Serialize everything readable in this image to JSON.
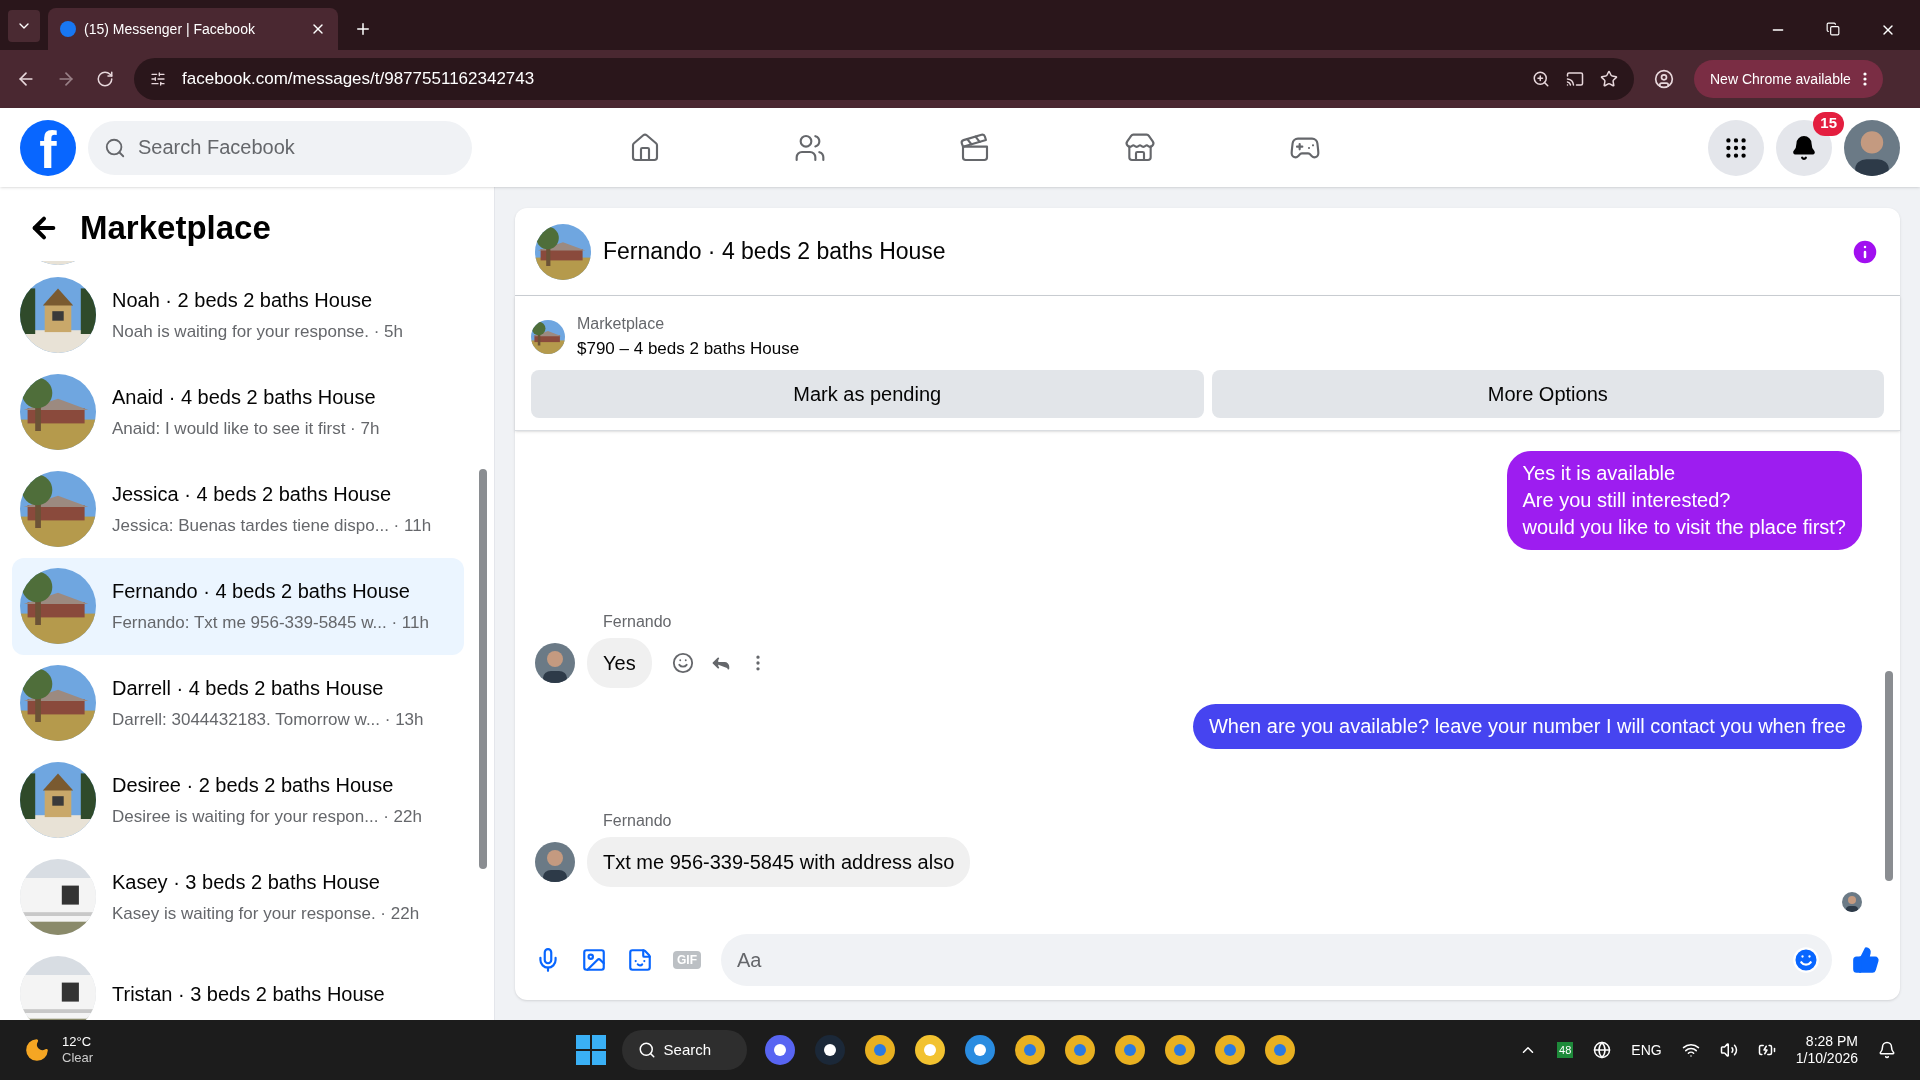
{
  "browser": {
    "tab_title": "(15) Messenger | Facebook",
    "url": "facebook.com/messages/t/9877551162342743",
    "update_button": "New Chrome available"
  },
  "header": {
    "logo": "f",
    "search_placeholder": "Search Facebook",
    "notification_count": "15"
  },
  "sidebar": {
    "title": "Marketplace",
    "conversations": [
      {
        "title": "Noah · 2 beds 2 baths House",
        "preview": "Noah is waiting for your response. · 5h",
        "selected": false,
        "kind": "cabin"
      },
      {
        "title": "Anaid · 4 beds 2 baths House",
        "preview": "Anaid: I would like to see it first · 7h",
        "selected": false,
        "kind": "brick"
      },
      {
        "title": "Jessica · 4 beds 2 baths House",
        "preview": "Jessica: Buenas tardes tiene dispo...  · 11h",
        "selected": false,
        "kind": "brick"
      },
      {
        "title": "Fernando · 4 beds 2 baths House",
        "preview": "Fernando: Txt me 956-339-5845 w... · 11h",
        "selected": true,
        "kind": "brick"
      },
      {
        "title": "Darrell · 4 beds 2 baths House",
        "preview": "Darrell: 3044432183. Tomorrow w...  · 13h",
        "selected": false,
        "kind": "brick"
      },
      {
        "title": "Desiree · 2 beds 2 baths House",
        "preview": "Desiree is waiting for your respon... · 22h",
        "selected": false,
        "kind": "cabin"
      },
      {
        "title": "Kasey · 3 beds 2 baths House",
        "preview": "Kasey is waiting for your response. · 22h",
        "selected": false,
        "kind": "mobile"
      },
      {
        "title": "Tristan · 3 beds 2 baths House",
        "selected": false,
        "kind": "mobile"
      }
    ]
  },
  "chat": {
    "title": "Fernando · 4 beds 2 baths House",
    "listing": {
      "label": "Marketplace",
      "text": "$790 – 4 beds 2 baths House"
    },
    "actions": [
      "Mark as pending",
      "More Options"
    ],
    "messages": [
      {
        "kind": "outgoing",
        "color": "#9d1df0",
        "lines": [
          "Yes it is available",
          "Are you still interested?",
          "would you like to visit the place first?"
        ]
      },
      {
        "kind": "incoming",
        "sender": "Fernando",
        "lines": [
          "Yes"
        ],
        "show_actions": true
      },
      {
        "kind": "outgoing",
        "color": "#4644f0",
        "lines": [
          "When are you available? leave your number I will contact you when free"
        ]
      },
      {
        "kind": "incoming",
        "sender": "Fernando",
        "lines": [
          "Txt me 956-339-5845 with address also"
        ],
        "show_actions": false
      }
    ],
    "composer": {
      "placeholder": "Aa",
      "gif_label": "GIF"
    }
  },
  "taskbar": {
    "temperature": "12°C",
    "weather": "Clear",
    "search": "Search",
    "tray_badge": "48",
    "language": "ENG",
    "time": "8:28 PM",
    "date": "1/10/2026"
  }
}
